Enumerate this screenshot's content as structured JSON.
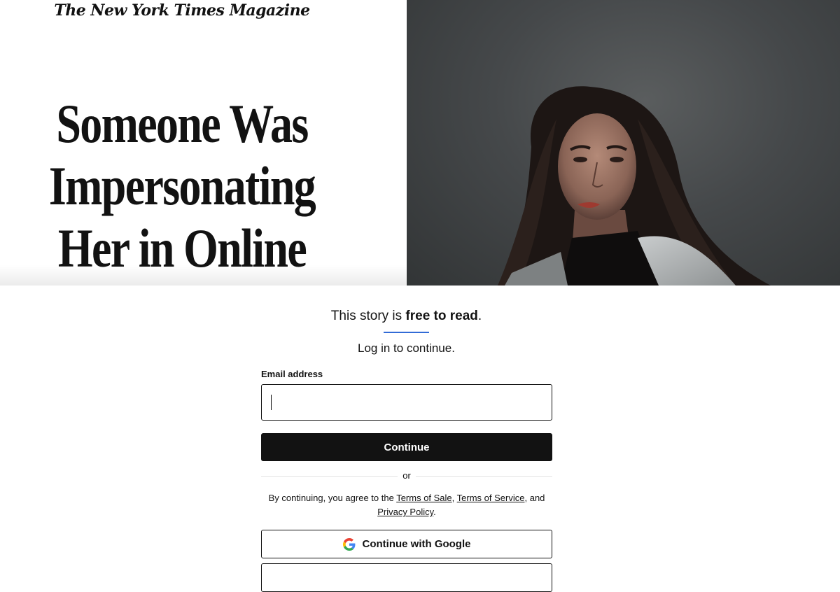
{
  "hero": {
    "masthead": "The New York Times Magazine",
    "headline": "Someone Was Impersonating Her in Online Affairs."
  },
  "gate": {
    "free_prefix": "This story is ",
    "free_bold": "free to read",
    "free_suffix": ".",
    "login_prompt": "Log in to continue.",
    "email_label": "Email address",
    "email_value": "",
    "continue_label": "Continue",
    "or_label": "or",
    "terms_prefix": "By continuing, you agree to the ",
    "terms_of_sale": "Terms of Sale",
    "terms_sep1": ", ",
    "terms_of_service": "Terms of Service",
    "terms_sep2": ", and ",
    "privacy_policy": "Privacy Policy",
    "terms_suffix": ".",
    "google_label": "Continue with Google"
  },
  "colors": {
    "accent_underline": "#326bd6",
    "primary_button": "#121212"
  },
  "icons": {
    "google": "google-g-icon"
  }
}
